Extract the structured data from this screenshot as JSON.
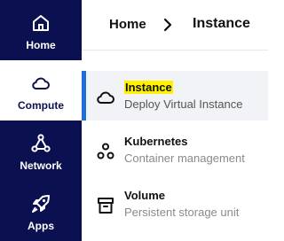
{
  "rail": {
    "items": [
      {
        "label": "Home",
        "icon": "home-icon"
      },
      {
        "label": "Compute",
        "icon": "cloud-icon"
      },
      {
        "label": "Network",
        "icon": "network-icon"
      },
      {
        "label": "Apps",
        "icon": "rocket-icon"
      }
    ],
    "active": "Compute"
  },
  "breadcrumb": {
    "home": "Home",
    "separator_icon": "chevron-right-icon",
    "current": "Instance"
  },
  "submenu": {
    "items": [
      {
        "title": "Instance",
        "subtitle": "Deploy Virtual Instance",
        "icon": "cloud-icon"
      },
      {
        "title": "Kubernetes",
        "subtitle": "Container management",
        "icon": "kubernetes-icon"
      },
      {
        "title": "Volume",
        "subtitle": "Persistent storage unit",
        "icon": "archive-box-icon"
      }
    ]
  },
  "colors": {
    "rail_bg": "#0b1150",
    "active_bar": "#1e6fd9",
    "highlight": "#fff200"
  }
}
